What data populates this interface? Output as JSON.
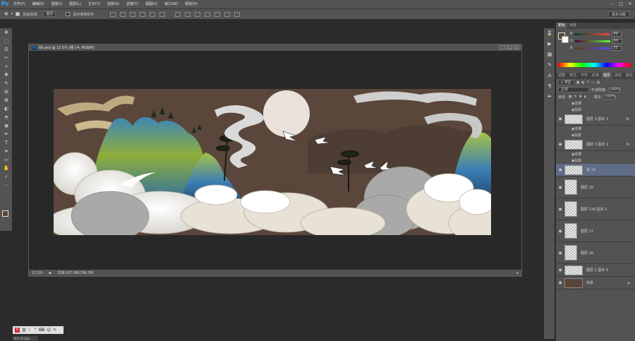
{
  "app": {
    "logo": "Ps"
  },
  "menu": [
    "文件(F)",
    "编辑(E)",
    "图像(I)",
    "图层(L)",
    "文字(Y)",
    "选择(S)",
    "滤镜(T)",
    "视图(V)",
    "窗口(W)",
    "帮助(H)"
  ],
  "window_controls": [
    "–",
    "□",
    "✕"
  ],
  "options": {
    "auto_select_label": "自动选择：",
    "auto_select_value": "图层",
    "show_transform_label": "显示变换控件",
    "workspace": "基本功能"
  },
  "tools": [
    "✥",
    "⬚",
    "ʘ",
    "✂",
    "⌖",
    "✚",
    "✎",
    "⊞",
    "✿",
    "◐",
    "⬘",
    "◉",
    "✒",
    "T",
    "➤",
    "▭",
    "✋",
    "⌕",
    "⋯"
  ],
  "document": {
    "title": "66.psd @ 12.5% (组 14, RGB/8)",
    "controls": [
      "–",
      "□",
      "✕"
    ],
    "zoom": "12.5%",
    "file_info": "文档:107.8M/796.3M"
  },
  "color_panel": {
    "tabs": [
      "颜色",
      "色板"
    ],
    "r": {
      "label": "R",
      "value": "89"
    },
    "g": {
      "label": "G",
      "value": "69"
    },
    "b": {
      "label": "B",
      "value": "55"
    },
    "fg_color": "#594537",
    "bg_color": "#ffffff"
  },
  "layers_panel": {
    "tabs": [
      "调整",
      "样式",
      "字符",
      "段落",
      "图层",
      "通道",
      "路径"
    ],
    "kind_filter": "ρ 类型",
    "blend_mode": "正常",
    "opacity_label": "不透明度:",
    "opacity_value": "100%",
    "lock_label": "锁定:",
    "fill_label": "填充:",
    "fill_value": "100%",
    "layers": [
      {
        "name": "效果",
        "sub": true
      },
      {
        "name": "投影",
        "sub": true
      },
      {
        "name": "图层 3 副本 3",
        "fx": "fx"
      },
      {
        "name": "效果",
        "sub": true
      },
      {
        "name": "投影",
        "sub": true
      },
      {
        "name": "图层 3 副本 2",
        "fx": "fx"
      },
      {
        "name": "效果",
        "sub": true
      },
      {
        "name": "投影",
        "sub": true
      },
      {
        "name": "组 14",
        "selected": true
      },
      {
        "name": "图层 18"
      },
      {
        "name": "图层 128 副本 2"
      },
      {
        "name": "图层 17"
      },
      {
        "name": "图层 16"
      },
      {
        "name": "图层 2 副本 9"
      },
      {
        "name": "背景"
      }
    ]
  },
  "bottom_bar": {
    "ime": "S",
    "ime_text": "英",
    "mini_bridge": "Mini Bridge"
  }
}
